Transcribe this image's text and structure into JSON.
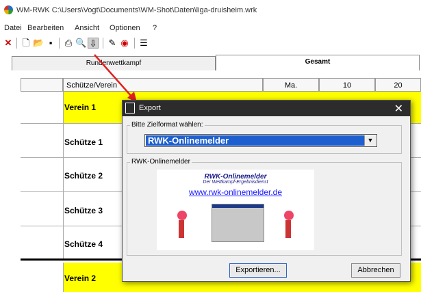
{
  "window": {
    "title": "WM-RWK C:\\Users\\Vogt\\Documents\\WM-Shot\\Daten\\liga-druisheim.wrk"
  },
  "menu": [
    "Datei",
    "Bearbeiten",
    "Ansicht",
    "Optionen",
    "?"
  ],
  "tabs": [
    {
      "label": "Rundenwettkampf"
    },
    {
      "label": "Gesamt"
    }
  ],
  "grid": {
    "headers": [
      "Schütze/Verein",
      "Ma.",
      "10",
      "20"
    ],
    "rows": [
      {
        "name": "Verein 1",
        "highlight": true
      },
      {
        "name": "Schütze 1",
        "highlight": false
      },
      {
        "name": "Schütze 2",
        "highlight": false
      },
      {
        "name": "Schütze 3",
        "highlight": false
      },
      {
        "name": "Schütze 4",
        "highlight": false
      },
      {
        "name": "Verein 2",
        "highlight": true
      }
    ]
  },
  "dialog": {
    "title": "Export",
    "format_label": "Bitte Zielformat wählen:",
    "format_value": "RWK-Onlinemelder",
    "preview_label": "RWK-Onlinemelder",
    "banner": {
      "title": "RWK-Onlinemelder",
      "subtitle": "Der Wettkampf-Ergebnisdienst",
      "url": "www.rwk-onlinemelder.de"
    },
    "export_button": "Exportieren...",
    "cancel_button": "Abbrechen"
  },
  "colors": {
    "highlight_row": "#ffff00",
    "arrow": "#e02020",
    "selection": "#1d5fcf",
    "link": "#1a1aff"
  }
}
